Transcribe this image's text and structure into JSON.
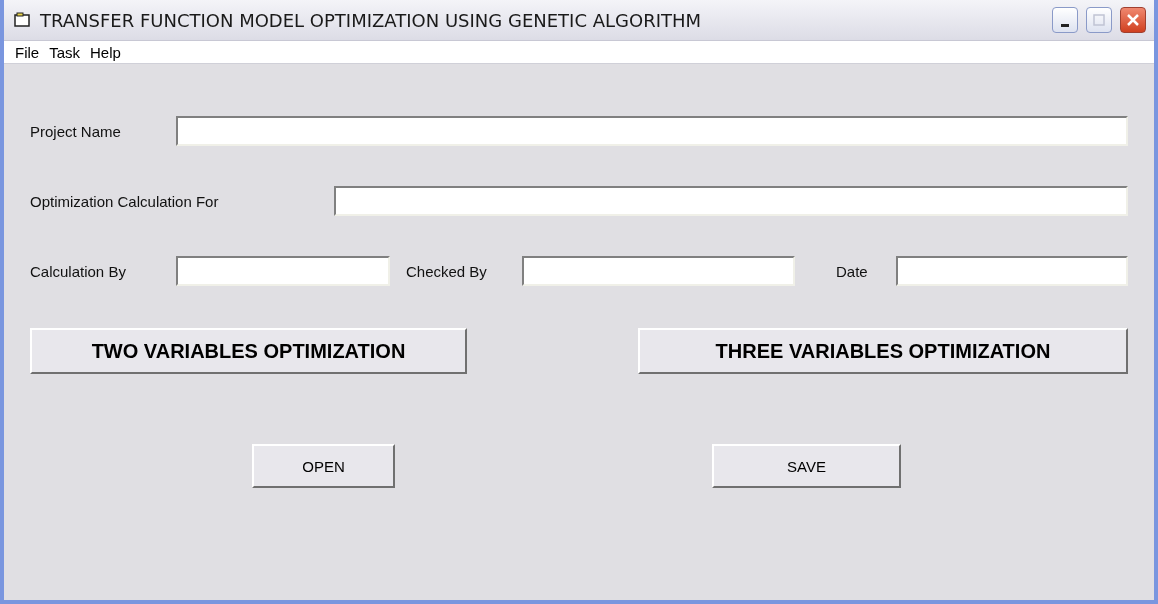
{
  "window": {
    "title": "TRANSFER FUNCTION MODEL OPTIMIZATION USING GENETIC ALGORITHM"
  },
  "menu": [
    "File",
    "Task",
    "Help"
  ],
  "project_name": {
    "label": "Project Name"
  },
  "optimization_for": {
    "label": "Optimization Calculation For"
  },
  "signoff": [
    {
      "label": "Calculation By"
    },
    {
      "label": "Checked By"
    },
    {
      "label": "Date"
    }
  ],
  "optimization_buttons": [
    "TWO VARIABLES OPTIMIZATION",
    "THREE VARIABLES OPTIMIZATION"
  ],
  "file_buttons": [
    "OPEN",
    "SAVE"
  ]
}
